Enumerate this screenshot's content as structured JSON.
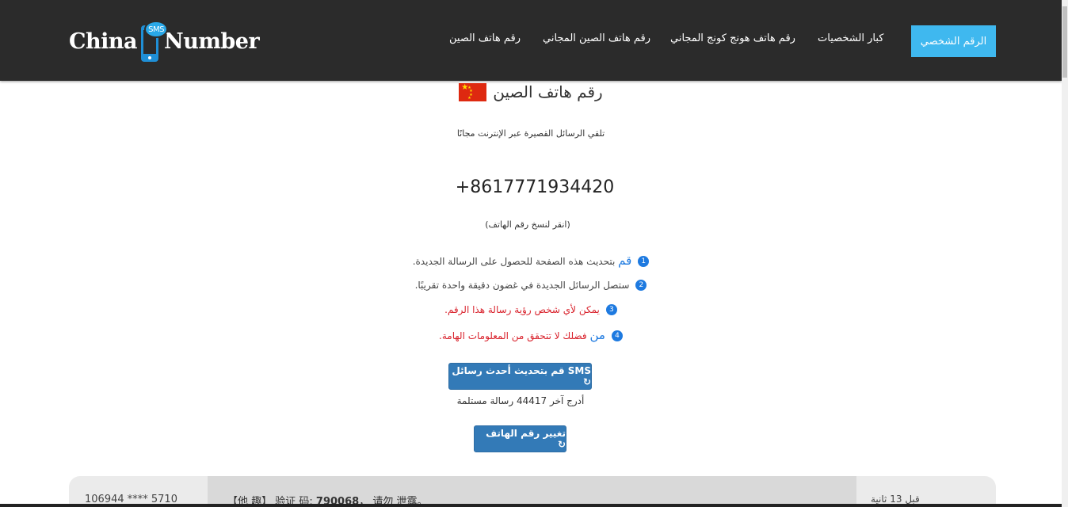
{
  "brand": {
    "part1": "China",
    "bubble": "SMS",
    "part2": "Number"
  },
  "nav": {
    "items": [
      "كبار الشخصيات",
      "رقم هاتف هونج كونج المجاني",
      "رقم هاتف الصين المجاني",
      "رقم هاتف الصين"
    ],
    "cta": "الرقم الشخصي"
  },
  "main": {
    "title": "رقم هاتف الصين",
    "subtitle": "تلقي الرسائل القصيرة عبر الإنترنت مجانًا",
    "phone_number": "+8617771934420",
    "copy_hint": "(انقر لنسخ رقم الهاتف)",
    "notes": [
      {
        "num": "1",
        "lead": "قم",
        "text": " بتحديث هذه الصفحة للحصول على الرسالة الجديدة."
      },
      {
        "num": "2",
        "lead": "",
        "text": "ستصل الرسائل الجديدة في غضون دقيقة واحدة تقريبًا."
      },
      {
        "num": "3",
        "lead": "",
        "text": "يمكن لأي شخص رؤية رسالة هذا الرقم."
      },
      {
        "num": "4",
        "lead": "من",
        "text": " فضلك لا تتحقق من المعلومات الهامة."
      }
    ],
    "refresh_button": "SMS قم بتحديث أحدث رسائل ↻",
    "received_text": "أدرج آخر 44417 رسالة مستلمة",
    "change_button": "تغيير رقم الهاتف ↻"
  },
  "messages": [
    {
      "sender": "106944 **** 5710",
      "text_prefix": "【他 趣】 验证 码: ",
      "code": "790068",
      "text_suffix": "， 请勿 泄露。",
      "time": "قبل 13 ثانية"
    }
  ],
  "colors": {
    "header_bg": "#2b2b2b",
    "cta_bg": "#3fb8ef",
    "button_bg": "#337ab7",
    "accent_blue": "#1e7ae0",
    "warning_red": "#d9232d"
  }
}
